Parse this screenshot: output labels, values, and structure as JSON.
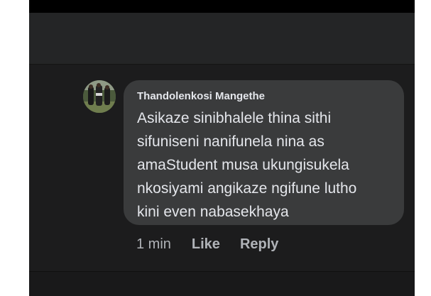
{
  "comment": {
    "author": "Thandolenkosi Mangethe",
    "lines": [
      "Asikaze sinibhalele thina sithi",
      "sifuniseni nanifunela nina as",
      "amaStudent musa ukungisukela",
      "nkosiyami angikaze ngifune lutho",
      "kini even nabasekhaya"
    ],
    "time": "1 min",
    "like_label": "Like",
    "reply_label": "Reply"
  },
  "colors": {
    "background": "#1c1c1d",
    "bubble": "#3a3b3c",
    "text": "#e4e6eb",
    "secondary_text": "#b0b3b8"
  }
}
